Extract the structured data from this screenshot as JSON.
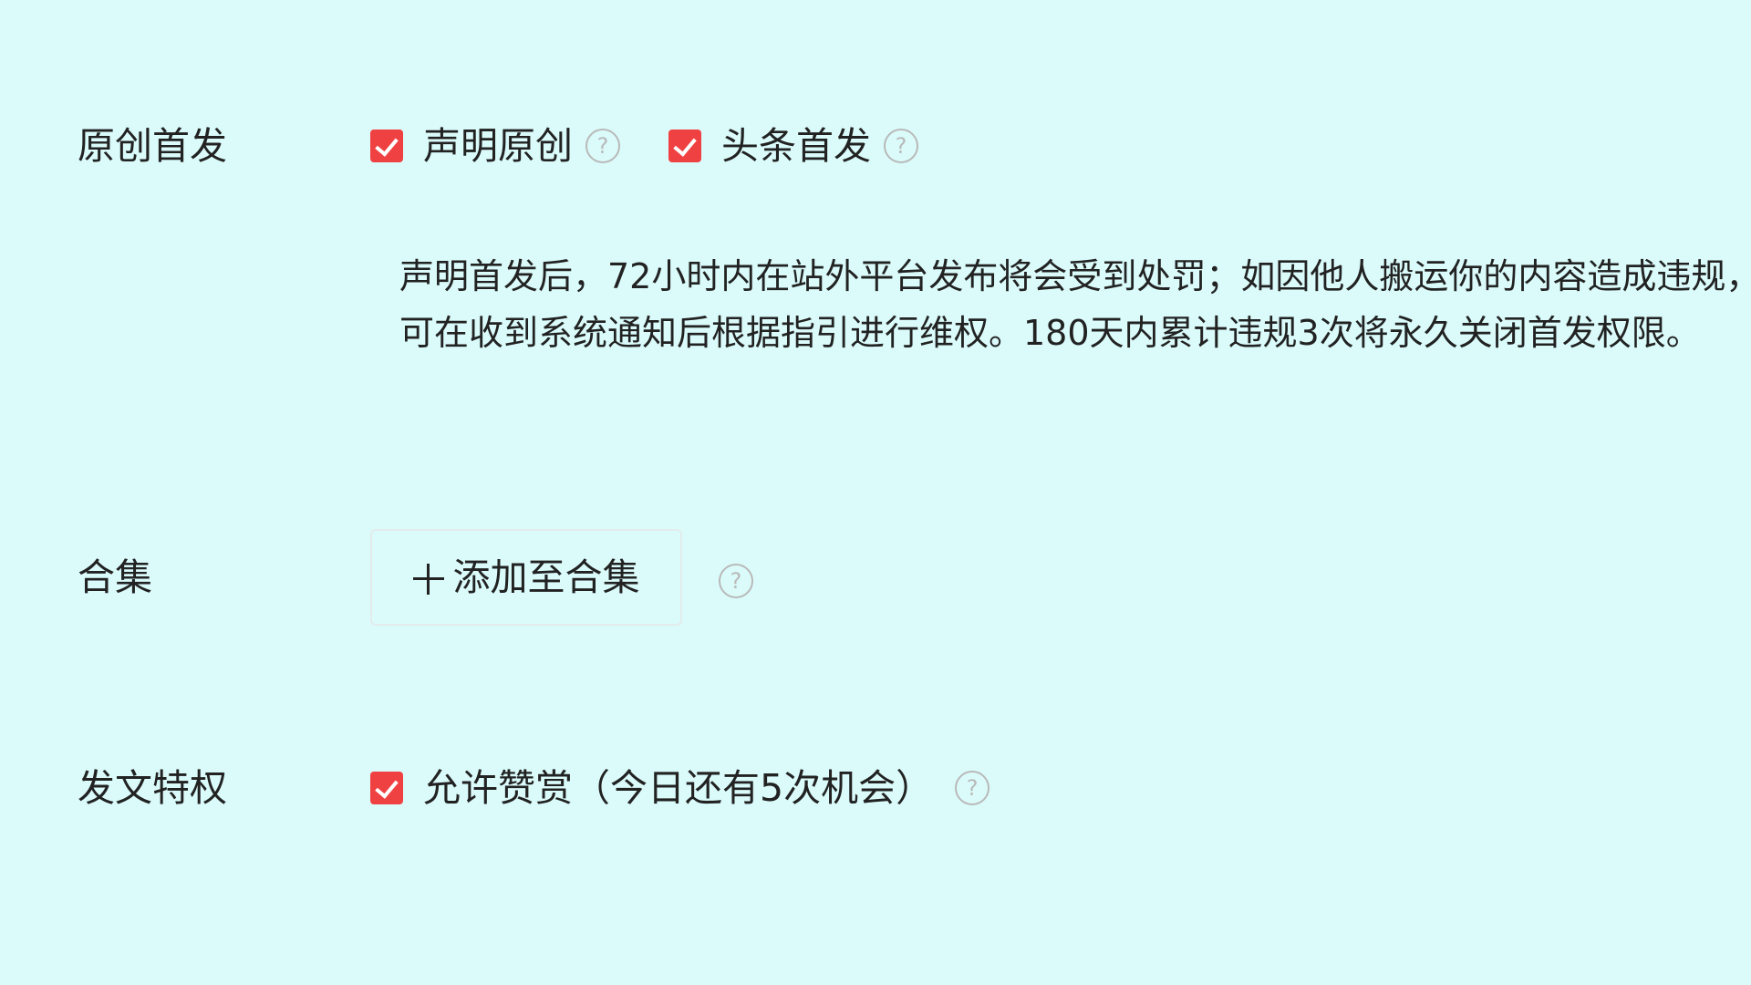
{
  "original_section": {
    "label": "原创首发",
    "declare_original": {
      "label": "声明原创",
      "checked": true
    },
    "toutiao_first": {
      "label": "头条首发",
      "checked": true
    },
    "description": [
      "声明首发后，72小时内在站外平台发布将会受到处罚；如因他人搬运你的内容造成违规，",
      "可在收到系统通知后根据指引进行维权。180天内累计违规3次将永久关闭首发权限。"
    ]
  },
  "collection_section": {
    "label": "合集",
    "add_button_label": "添加至合集"
  },
  "privilege_section": {
    "label": "发文特权",
    "allow_tips": {
      "label": "允许赞赏（今日还有5次机会）",
      "checked": true
    }
  },
  "icons": {
    "help": "question-circle-icon",
    "plus": "plus-icon",
    "check": "checkmark-icon"
  },
  "colors": {
    "background": "#dbfbfb",
    "checkbox": "#f04142",
    "text": "#222222",
    "help_icon": "#b9b9b9"
  }
}
